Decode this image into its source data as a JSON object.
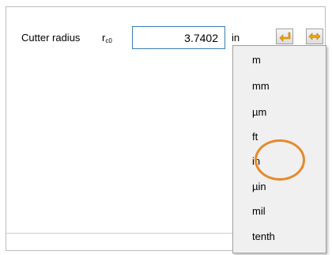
{
  "field": {
    "label": "Cutter radius",
    "symbol_main": "r",
    "symbol_sub": "c0",
    "value": "3.7402",
    "unit": "in"
  },
  "toolbar": {
    "btn_a_icon": "arrow-left-icon",
    "btn_b_icon": "double-arrow-icon",
    "icon_color": "#f0a500"
  },
  "dropdown": {
    "options": [
      "m",
      "mm",
      "µm",
      "ft",
      "in",
      "µin",
      "mil",
      "tenth"
    ],
    "selected": "in"
  },
  "highlight_color": "#e58a2c"
}
